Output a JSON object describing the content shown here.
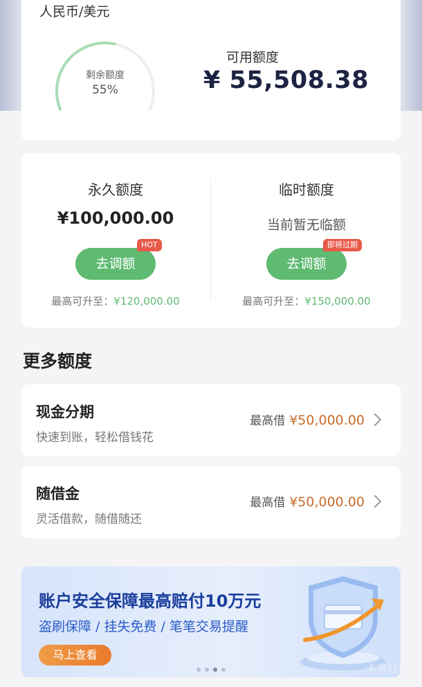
{
  "limit_card": {
    "currency": "人民币/美元",
    "remaining_label": "剩余额度",
    "remaining_percent": "55%",
    "remaining_fraction": 0.55,
    "available_label": "可用额度",
    "available_amount": "¥ 55,508.38"
  },
  "permanent": {
    "title": "永久额度",
    "amount": "¥100,000.00",
    "button": "去调额",
    "badge": "HOT",
    "max_label": "最高可升至：",
    "max_amount": "¥120,000.00"
  },
  "temporary": {
    "title": "临时额度",
    "status": "当前暂无临额",
    "button": "去调额",
    "badge": "即将过期",
    "max_label": "最高可升至：",
    "max_amount": "¥150,000.00"
  },
  "more_section": {
    "title": "更多额度",
    "items": [
      {
        "title": "现金分期",
        "subtitle": "快速到账，轻松借钱花",
        "max_label": "最高借",
        "max_amount": "¥50,000.00"
      },
      {
        "title": "随借金",
        "subtitle": "灵活借款，随借随还",
        "max_label": "最高借",
        "max_amount": "¥50,000.00"
      }
    ]
  },
  "banner": {
    "title": "账户安全保障最高赔付10万元",
    "subtitle": "盗刷保障 / 挂失免费 / 笔笔交易提醒",
    "button": "马上查看"
  },
  "watermark": "卡农社区",
  "colors": {
    "accent_green": "#5fba72",
    "amount_orange": "#c86b2a",
    "badge_red": "#e85a4a",
    "banner_blue": "#1a3d9c"
  }
}
